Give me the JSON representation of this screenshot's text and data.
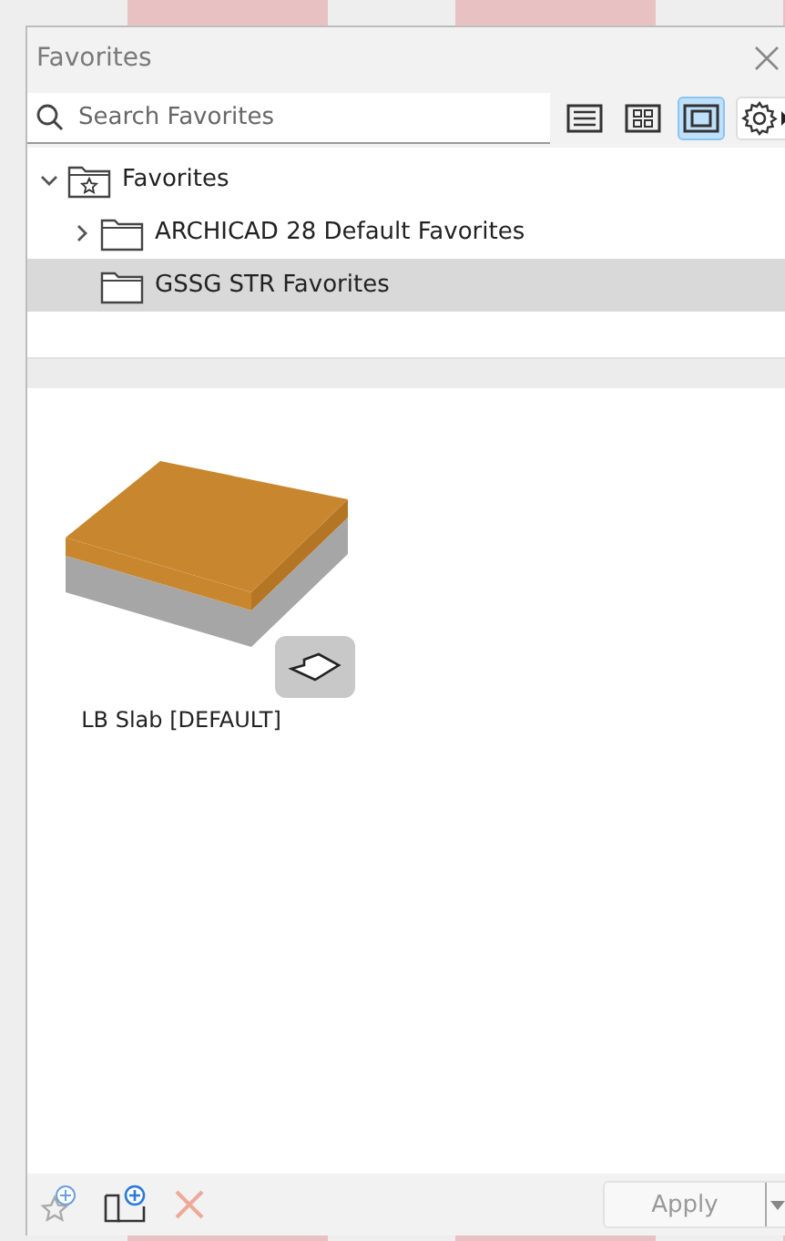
{
  "window": {
    "title": "Favorites"
  },
  "search": {
    "placeholder": "Search Favorites"
  },
  "view_modes": [
    {
      "kind": "list",
      "selected": false
    },
    {
      "kind": "grid",
      "selected": false
    },
    {
      "kind": "preview",
      "selected": true
    }
  ],
  "tree": [
    {
      "label": "Favorites",
      "kind": "root",
      "expanded": true,
      "selected": false,
      "children": [
        {
          "label": "ARCHICAD 28 Default Favorites",
          "kind": "folder",
          "expanded": false,
          "selected": false
        },
        {
          "label": "GSSG STR Favorites",
          "kind": "folder",
          "selected": true
        }
      ]
    }
  ],
  "items": [
    {
      "label": "LB Slab [DEFAULT]",
      "selected": false
    }
  ],
  "footer": {
    "delete_disabled": true,
    "apply": {
      "label": "Apply",
      "disabled": true
    }
  }
}
